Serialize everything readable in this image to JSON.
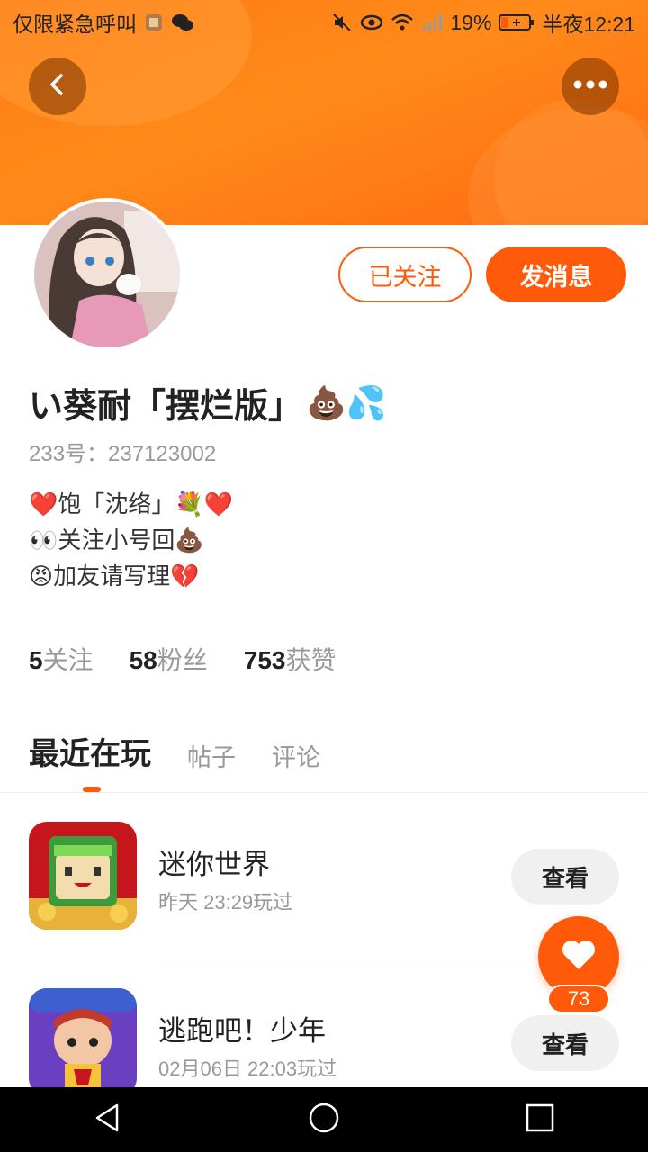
{
  "status_bar": {
    "carrier_text": "仅限紧急呼叫",
    "battery": "19%",
    "time": "半夜12:21"
  },
  "header": {
    "back_icon": "chevron-left-icon",
    "more_icon": "more-dots-icon"
  },
  "profile": {
    "follow_button": "已关注",
    "message_button": "发消息",
    "nickname": "い葵耐「摆烂版」",
    "nickname_emoji": "💩💦",
    "uid": "233号：237123002",
    "bio": [
      "❤️饱「沈络」💐❤️",
      "👀关注小号回💩",
      "😡加友请写理💔"
    ],
    "stats": [
      {
        "num": "5",
        "label": "关注"
      },
      {
        "num": "58",
        "label": "粉丝"
      },
      {
        "num": "753",
        "label": "获赞"
      }
    ]
  },
  "tabs": [
    {
      "label": "最近在玩",
      "active": true
    },
    {
      "label": "帖子",
      "active": false
    },
    {
      "label": "评论",
      "active": false
    }
  ],
  "games": [
    {
      "name": "迷你世界",
      "time": "昨天 23:29玩过",
      "button": "查看"
    },
    {
      "name": "逃跑吧！少年",
      "time": "02月06日 22:03玩过",
      "button": "查看"
    }
  ],
  "like": {
    "count": "73"
  },
  "colors": {
    "accent": "#ff5a0a",
    "banner": "#ff7a12"
  }
}
